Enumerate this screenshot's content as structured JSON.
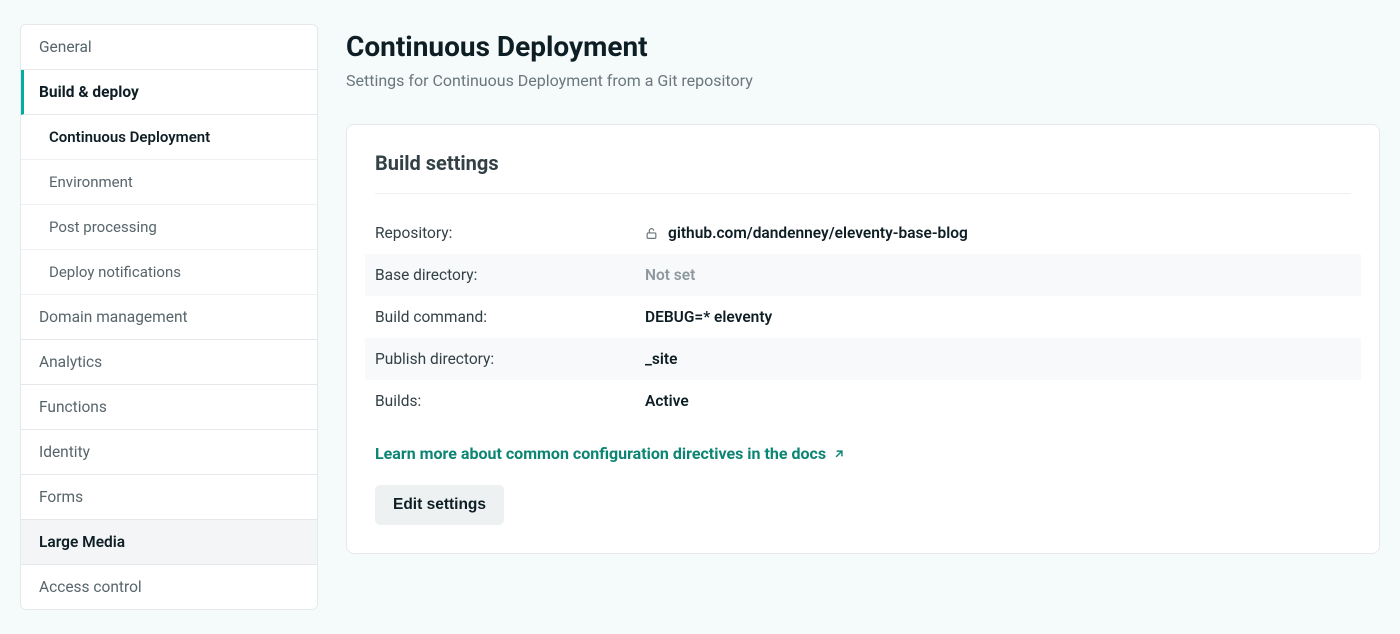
{
  "sidebar": {
    "items": [
      {
        "label": "General"
      },
      {
        "label": "Build & deploy"
      },
      {
        "label": "Domain management"
      },
      {
        "label": "Analytics"
      },
      {
        "label": "Functions"
      },
      {
        "label": "Identity"
      },
      {
        "label": "Forms"
      },
      {
        "label": "Large Media"
      },
      {
        "label": "Access control"
      }
    ],
    "subitems": [
      {
        "label": "Continuous Deployment"
      },
      {
        "label": "Environment"
      },
      {
        "label": "Post processing"
      },
      {
        "label": "Deploy notifications"
      }
    ]
  },
  "page": {
    "title": "Continuous Deployment",
    "subtitle": "Settings for Continuous Deployment from a Git repository"
  },
  "card": {
    "title": "Build settings",
    "rows": {
      "repository_label": "Repository:",
      "repository_value": "github.com/dandenney/eleventy-base-blog",
      "basedir_label": "Base directory:",
      "basedir_value": "Not set",
      "buildcmd_label": "Build command:",
      "buildcmd_value": "DEBUG=* eleventy",
      "publishdir_label": "Publish directory:",
      "publishdir_value": "_site",
      "builds_label": "Builds:",
      "builds_value": "Active"
    },
    "docs_link": "Learn more about common configuration directives in the docs",
    "edit_button": "Edit settings"
  }
}
